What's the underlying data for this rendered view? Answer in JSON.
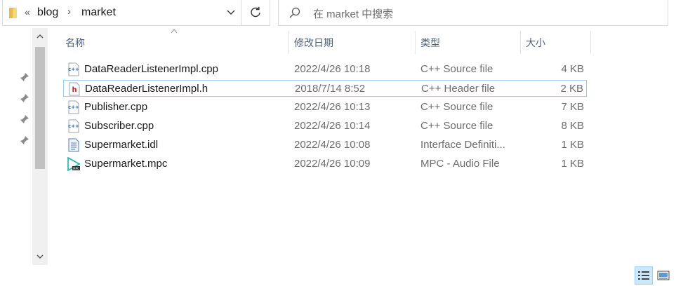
{
  "address": {
    "overflow_glyph": "«",
    "crumbs": [
      "blog",
      "market"
    ],
    "separator": "›"
  },
  "search": {
    "placeholder": "在 market 中搜索"
  },
  "columns": {
    "name": "名称",
    "date": "修改日期",
    "type": "类型",
    "size": "大小"
  },
  "files": [
    {
      "name": "DataReaderListenerImpl.cpp",
      "date": "2022/4/26 10:18",
      "type": "C++ Source file",
      "size": "4 KB",
      "icon": "cpp-file-icon"
    },
    {
      "name": "DataReaderListenerImpl.h",
      "date": "2018/7/14 8:52",
      "type": "C++ Header file",
      "size": "2 KB",
      "icon": "header-file-icon"
    },
    {
      "name": "Publisher.cpp",
      "date": "2022/4/26 10:13",
      "type": "C++ Source file",
      "size": "7 KB",
      "icon": "cpp-file-icon"
    },
    {
      "name": "Subscriber.cpp",
      "date": "2022/4/26 10:14",
      "type": "C++ Source file",
      "size": "8 KB",
      "icon": "cpp-file-icon"
    },
    {
      "name": "Supermarket.idl",
      "date": "2022/4/26 10:08",
      "type": "Interface Definiti...",
      "size": "1 KB",
      "icon": "idl-file-icon"
    },
    {
      "name": "Supermarket.mpc",
      "date": "2022/4/26 10:09",
      "type": "MPC - Audio File",
      "size": "1 KB",
      "icon": "mpc-file-icon"
    }
  ],
  "selected_index": 1,
  "colors": {
    "accent": "#0078d7",
    "selection_border": "#9fcdea",
    "header_text": "#4c607a"
  }
}
